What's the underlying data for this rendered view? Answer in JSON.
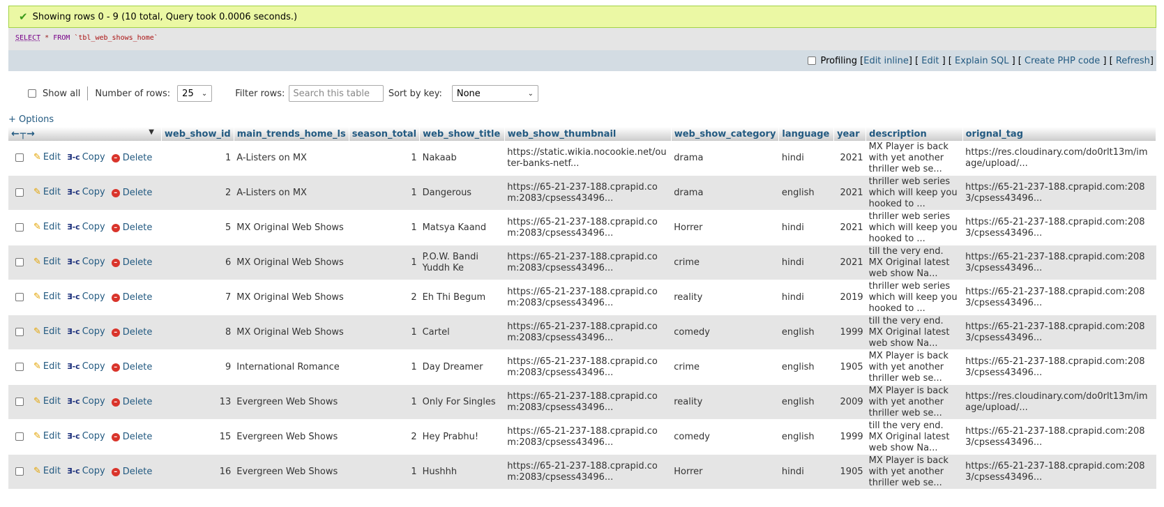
{
  "message": {
    "icon": "check-icon",
    "text": "Showing rows 0 - 9 (10 total, Query took 0.0006 seconds.)"
  },
  "sql": {
    "select": "SELECT",
    "star": "*",
    "from": "FROM",
    "table": "`tbl_web_shows_home`"
  },
  "tools": {
    "profiling": "Profiling",
    "edit_inline": "Edit inline",
    "edit": "Edit",
    "explain": "Explain SQL",
    "create_php": "Create PHP code",
    "refresh": "Refresh"
  },
  "nav": {
    "show_all": "Show all",
    "rows_label": "Number of rows:",
    "rows_value": "25",
    "filter_label": "Filter rows:",
    "filter_placeholder": "Search this table",
    "sort_label": "Sort by key:",
    "sort_value": "None"
  },
  "options_label": "+ Options",
  "actions": {
    "edit": "Edit",
    "copy": "Copy",
    "delete": "Delete"
  },
  "columns": [
    "web_show_id",
    "main_trends_home_ls",
    "season_total",
    "web_show_title",
    "web_show_thumbnail",
    "web_show_category",
    "language",
    "year",
    "description",
    "orignal_tag"
  ],
  "rows": [
    {
      "id": "1",
      "trend": "A-Listers on MX",
      "season": "1",
      "title": "Nakaab",
      "thumb": "https://static.wikia.nocookie.net/outer-banks-netf...",
      "category": "drama",
      "language": "hindi",
      "year": "2021",
      "description": "MX Player is back with yet another thriller web se...",
      "tag": "https://res.cloudinary.com/do0rlt13m/image/upload/..."
    },
    {
      "id": "2",
      "trend": "A-Listers on MX",
      "season": "1",
      "title": "Dangerous",
      "thumb": "https://65-21-237-188.cprapid.com:2083/cpsess43496...",
      "category": "drama",
      "language": "english",
      "year": "2021",
      "description": "thriller web series which will keep you hooked to ...",
      "tag": "https://65-21-237-188.cprapid.com:2083/cpsess43496..."
    },
    {
      "id": "5",
      "trend": "MX Original Web Shows",
      "season": "1",
      "title": "Matsya Kaand",
      "thumb": "https://65-21-237-188.cprapid.com:2083/cpsess43496...",
      "category": "Horrer",
      "language": "hindi",
      "year": "2021",
      "description": "thriller web series which will keep you hooked to ...",
      "tag": "https://65-21-237-188.cprapid.com:2083/cpsess43496..."
    },
    {
      "id": "6",
      "trend": "MX Original Web Shows",
      "season": "1",
      "title": "P.O.W. Bandi Yuddh Ke",
      "thumb": "https://65-21-237-188.cprapid.com:2083/cpsess43496...",
      "category": "crime",
      "language": "hindi",
      "year": "2021",
      "description": "till the very end. MX Original latest web show Na...",
      "tag": "https://65-21-237-188.cprapid.com:2083/cpsess43496..."
    },
    {
      "id": "7",
      "trend": "MX Original Web Shows",
      "season": "2",
      "title": "Eh Thi Begum",
      "thumb": "https://65-21-237-188.cprapid.com:2083/cpsess43496...",
      "category": "reality",
      "language": "hindi",
      "year": "2019",
      "description": "thriller web series which will keep you hooked to ...",
      "tag": "https://65-21-237-188.cprapid.com:2083/cpsess43496..."
    },
    {
      "id": "8",
      "trend": "MX Original Web Shows",
      "season": "1",
      "title": "Cartel",
      "thumb": "https://65-21-237-188.cprapid.com:2083/cpsess43496...",
      "category": "comedy",
      "language": "english",
      "year": "1999",
      "description": "till the very end. MX Original latest web show Na...",
      "tag": "https://65-21-237-188.cprapid.com:2083/cpsess43496..."
    },
    {
      "id": "9",
      "trend": "International Romance",
      "season": "1",
      "title": "Day Dreamer",
      "thumb": "https://65-21-237-188.cprapid.com:2083/cpsess43496...",
      "category": "crime",
      "language": "english",
      "year": "1905",
      "description": "MX Player is back with yet another thriller web se...",
      "tag": "https://65-21-237-188.cprapid.com:2083/cpsess43496..."
    },
    {
      "id": "13",
      "trend": "Evergreen Web Shows",
      "season": "1",
      "title": "Only For Singles",
      "thumb": "https://65-21-237-188.cprapid.com:2083/cpsess43496...",
      "category": "reality",
      "language": "english",
      "year": "2009",
      "description": "MX Player is back with yet another thriller web se...",
      "tag": "https://res.cloudinary.com/do0rlt13m/image/upload/..."
    },
    {
      "id": "15",
      "trend": "Evergreen Web Shows",
      "season": "2",
      "title": "Hey Prabhu!",
      "thumb": "https://65-21-237-188.cprapid.com:2083/cpsess43496...",
      "category": "comedy",
      "language": "english",
      "year": "1999",
      "description": "till the very end. MX Original latest web show Na...",
      "tag": "https://65-21-237-188.cprapid.com:2083/cpsess43496..."
    },
    {
      "id": "16",
      "trend": "Evergreen Web Shows",
      "season": "1",
      "title": "Hushhh",
      "thumb": "https://65-21-237-188.cprapid.com:2083/cpsess43496...",
      "category": "Horrer",
      "language": "hindi",
      "year": "1905",
      "description": "MX Player is back with yet another thriller web se...",
      "tag": "https://65-21-237-188.cprapid.com:2083/cpsess43496..."
    }
  ]
}
